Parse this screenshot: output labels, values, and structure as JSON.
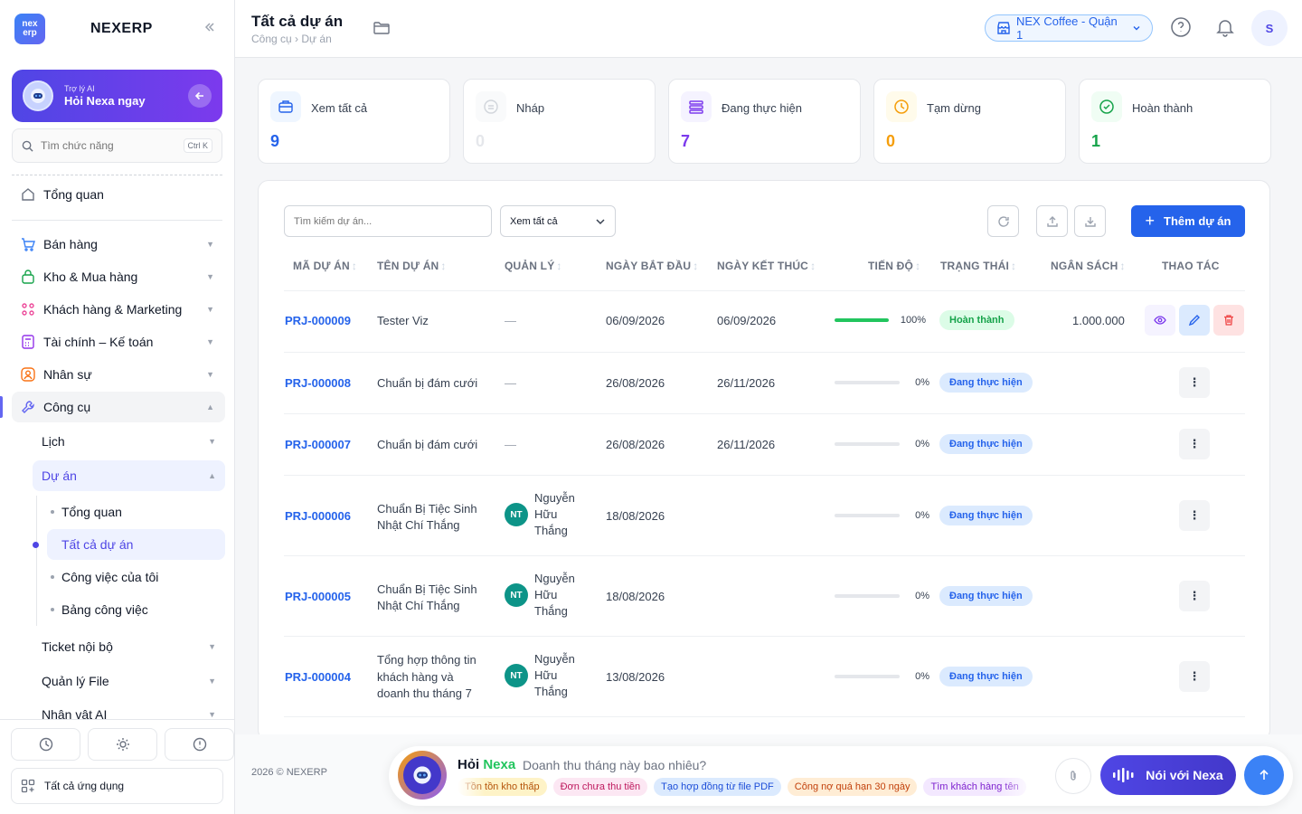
{
  "brand": {
    "logo_text": "nex erp",
    "name": "NEXERP"
  },
  "ai_card": {
    "small": "Trợ lý AI",
    "big": "Hỏi Nexa ngay"
  },
  "sidebar_search": {
    "placeholder": "Tìm chức năng",
    "shortcut": "Ctrl K"
  },
  "nav": {
    "overview": "Tổng quan",
    "sales": "Bán hàng",
    "inventory": "Kho & Mua hàng",
    "customers": "Khách hàng & Marketing",
    "finance": "Tài chính – Kế toán",
    "hr": "Nhân sự",
    "tools": "Công cụ",
    "calendar": "Lịch",
    "projects": "Dự án",
    "projects_overview": "Tổng quan",
    "all_projects": "Tất cả dự án",
    "my_tasks": "Công việc của tôi",
    "task_board": "Bảng công việc",
    "ticket": "Ticket nội bộ",
    "files": "Quản lý File",
    "ai_character": "Nhân vật AI",
    "all_apps": "Tất cả ứng dụng"
  },
  "header": {
    "title": "Tất cả dự án",
    "breadcrumb": "Công cụ › Dự án",
    "branch": "NEX Coffee - Quận 1",
    "avatar": "S"
  },
  "stats": [
    {
      "label": "Xem tất cả",
      "value": "9",
      "color": "#2563eb"
    },
    {
      "label": "Nháp",
      "value": "0",
      "color": "#d1d5db"
    },
    {
      "label": "Đang thực hiện",
      "value": "7",
      "color": "#7c3aed"
    },
    {
      "label": "Tạm dừng",
      "value": "0",
      "color": "#f59e0b"
    },
    {
      "label": "Hoàn thành",
      "value": "1",
      "color": "#16a34a"
    }
  ],
  "toolbar": {
    "search_placeholder": "Tìm kiếm dự án...",
    "filter": "Xem tất cả",
    "add": "Thêm dự án"
  },
  "table": {
    "headers": [
      "MÃ DỰ ÁN",
      "TÊN DỰ ÁN",
      "QUẢN LÝ",
      "NGÀY BẮT ĐẦU",
      "NGÀY KẾT THÚC",
      "TIẾN ĐỘ",
      "TRẠNG THÁI",
      "NGÂN SÁCH",
      "THAO TÁC"
    ],
    "rows": [
      {
        "code": "PRJ-000009",
        "name1": "Tester Viz",
        "name2": "",
        "name3": "",
        "manager": "—",
        "initials": "",
        "mgr1": "",
        "mgr2": "",
        "mgr3": "",
        "start": "06/09/2026",
        "end": "06/09/2026",
        "progress": 100,
        "progress_label": "100%",
        "status": "Hoàn thành",
        "budget": "1.000.000"
      },
      {
        "code": "PRJ-000008",
        "name1": "Chuẩn bị đám cưới",
        "name2": "",
        "name3": "",
        "manager": "—",
        "initials": "",
        "mgr1": "",
        "mgr2": "",
        "mgr3": "",
        "start": "26/08/2026",
        "end": "26/11/2026",
        "progress": 0,
        "progress_label": "0%",
        "status": "Đang thực hiện",
        "budget": ""
      },
      {
        "code": "PRJ-000007",
        "name1": "Chuẩn bị đám cưới",
        "name2": "",
        "name3": "",
        "manager": "—",
        "initials": "",
        "mgr1": "",
        "mgr2": "",
        "mgr3": "",
        "start": "26/08/2026",
        "end": "26/11/2026",
        "progress": 0,
        "progress_label": "0%",
        "status": "Đang thực hiện",
        "budget": ""
      },
      {
        "code": "PRJ-000006",
        "name1": "Chuẩn Bị Tiệc Sinh",
        "name2": "Nhật Chí Thắng",
        "name3": "",
        "manager": "",
        "initials": "NT",
        "mgr1": "Nguyễn",
        "mgr2": "Hữu",
        "mgr3": "Thắng",
        "start": "18/08/2026",
        "end": "",
        "progress": 0,
        "progress_label": "0%",
        "status": "Đang thực hiện",
        "budget": ""
      },
      {
        "code": "PRJ-000005",
        "name1": "Chuẩn Bị Tiệc Sinh",
        "name2": "Nhật Chí Thắng",
        "name3": "",
        "manager": "",
        "initials": "NT",
        "mgr1": "Nguyễn",
        "mgr2": "Hữu",
        "mgr3": "Thắng",
        "start": "18/08/2026",
        "end": "",
        "progress": 0,
        "progress_label": "0%",
        "status": "Đang thực hiện",
        "budget": ""
      },
      {
        "code": "PRJ-000004",
        "name1": "Tổng hợp thông tin",
        "name2": "khách hàng và",
        "name3": "doanh thu tháng 7",
        "manager": "",
        "initials": "NT",
        "mgr1": "Nguyễn",
        "mgr2": "Hữu",
        "mgr3": "Thắng",
        "start": "13/08/2026",
        "end": "",
        "progress": 0,
        "progress_label": "0%",
        "status": "Đang thực hiện",
        "budget": ""
      }
    ]
  },
  "footer": {
    "copyright": "2026 © NEXERP",
    "ask_prefix": "Hỏi",
    "ask_brand": "Nexa",
    "question": "Doanh thu tháng này bao nhiêu?",
    "chips": [
      "Tồn tồn kho thấp",
      "Đơn chưa thu tiền",
      "Tạo hợp đồng từ file PDF",
      "Công nợ quá hạn 30 ngày",
      "Tìm khách hàng tên"
    ],
    "talk": "Nói với Nexa"
  },
  "colors": {
    "accent": "#4f46e5",
    "primary": "#2563eb",
    "success": "#16a34a"
  }
}
